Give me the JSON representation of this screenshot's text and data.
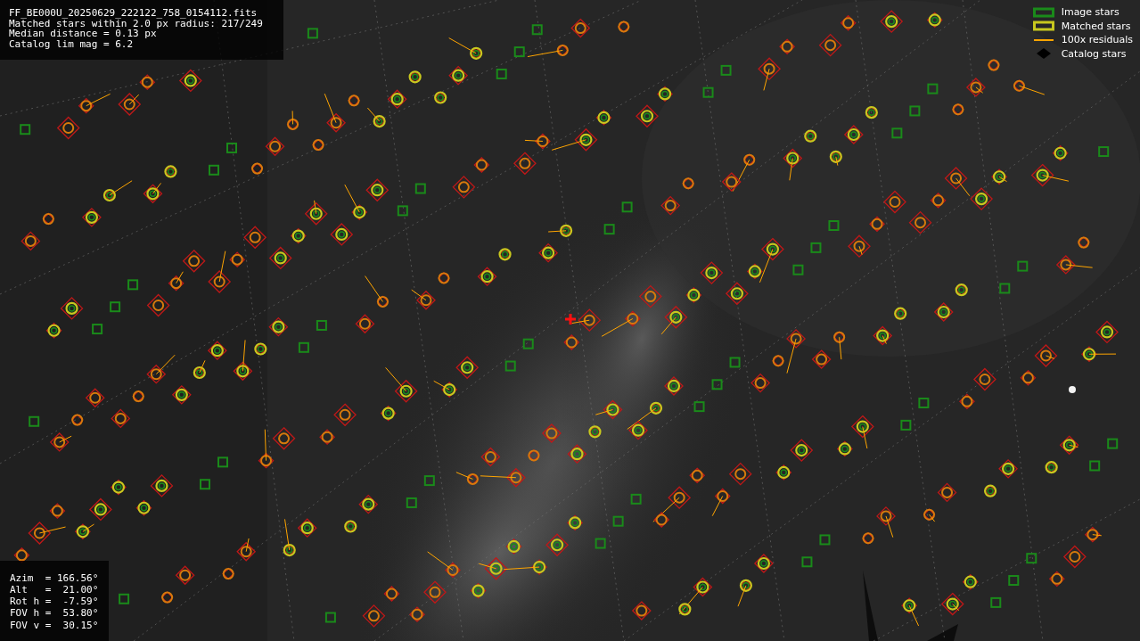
{
  "header_lines": [
    "FF_BE000U_20250629_222122_758_0154112.fits",
    "Matched stars within 2.0 px radius: 217/249",
    "Median distance = 0.13 px",
    "Catalog lim mag = 6.2"
  ],
  "legend": [
    {
      "kind": "box",
      "label": "Image stars",
      "color": "#1a8a1a"
    },
    {
      "kind": "box",
      "label": "Matched stars",
      "color": "#c8c81e"
    },
    {
      "kind": "line",
      "label": "100x residuals",
      "color": "#ffa500"
    },
    {
      "kind": "diamond",
      "label": "Catalog stars",
      "color": "#000000"
    }
  ],
  "pointing_lines": [
    "Azim  = 166.56°",
    "Alt   =  21.00°",
    "Rot h =  -7.59°",
    "FOV h =  53.80°",
    "FOV v =  30.15°"
  ]
}
